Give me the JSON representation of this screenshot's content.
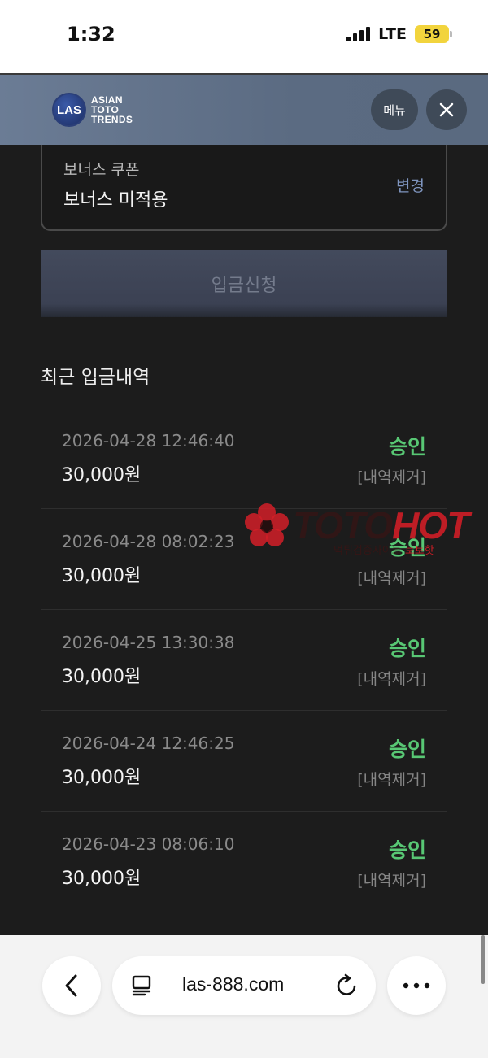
{
  "status_bar": {
    "time": "1:32",
    "network": "LTE",
    "battery": "59",
    "battery_color": "#f2d43d"
  },
  "header": {
    "logo_badge": "LAS",
    "logo_lines": [
      "ASIAN",
      "TOTO",
      "TRENDS"
    ],
    "menu_label": "메뉴",
    "close_icon": "close-icon"
  },
  "coupon": {
    "label": "보너스 쿠폰",
    "value": "보너스 미적용",
    "change_label": "변경"
  },
  "deposit_button": "입금신청",
  "history": {
    "title": "최근 입금내역",
    "items": [
      {
        "date": "2026-04-28 12:46:40",
        "amount": "30,000원",
        "status": "승인",
        "remove": "[내역제거]"
      },
      {
        "date": "2026-04-28 08:02:23",
        "amount": "30,000원",
        "status": "승인",
        "remove": "[내역제거]"
      },
      {
        "date": "2026-04-25 13:30:38",
        "amount": "30,000원",
        "status": "승인",
        "remove": "[내역제거]"
      },
      {
        "date": "2026-04-24 12:46:25",
        "amount": "30,000원",
        "status": "승인",
        "remove": "[내역제거]"
      },
      {
        "date": "2026-04-23 08:06:10",
        "amount": "30,000원",
        "status": "승인",
        "remove": "[내역제거]"
      }
    ],
    "status_color": "#58c774"
  },
  "watermark": {
    "text_a": "TOTO",
    "text_b": "HOT",
    "sub_a": "먹튀검증사이트",
    "sub_b": "토토핫"
  },
  "browser": {
    "url": "las-888.com",
    "icons": [
      "back-icon",
      "reader-icon",
      "reload-icon",
      "more-icon"
    ]
  }
}
